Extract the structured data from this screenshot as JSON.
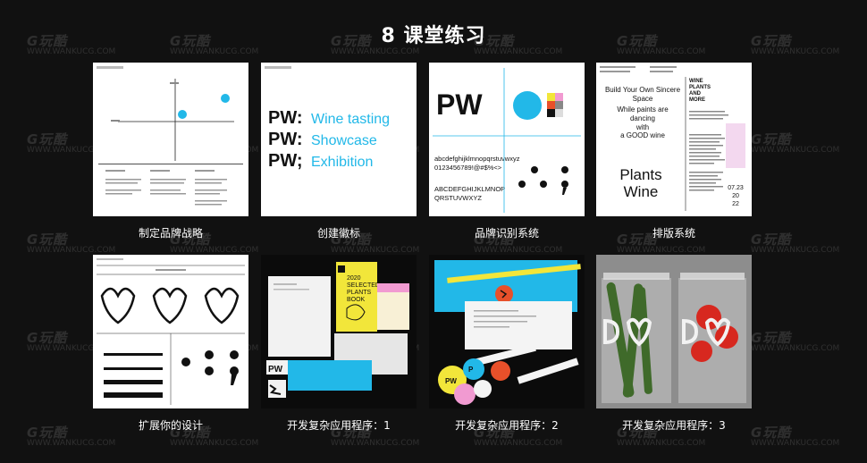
{
  "title": "8 课堂练习",
  "watermark": {
    "brand": "G玩酷",
    "site": "WWW.WANKUCG.COM"
  },
  "cards": [
    {
      "caption": "制定品牌战略"
    },
    {
      "caption": "创建徽标",
      "logo_lines": [
        "Wine tasting",
        "Showcase",
        "Exhibition"
      ]
    },
    {
      "caption": "品牌识别系统",
      "lower": "abcdefghijklmnopqrstuvwxyz",
      "digits": "0123456789!@#$%<>",
      "upper1": "ABCDEFGHIJKLMNOP",
      "upper2": "QRSTUVWXYZ"
    },
    {
      "caption": "排版系统",
      "headline": [
        "Build Your Own Sincere",
        "Space",
        "While paints are",
        "dancing",
        "with",
        "a GOOD wine"
      ],
      "big": [
        "Plants",
        "Wine"
      ],
      "side": [
        "WINE",
        "PLANTS",
        "AND",
        "MORE"
      ],
      "date": [
        "07.23",
        "20",
        "22"
      ]
    },
    {
      "caption": "扩展你的设计"
    },
    {
      "caption": "开发复杂应用程序：1",
      "book": [
        "2020",
        "SELECTED",
        "PLANTS",
        "BOOK"
      ]
    },
    {
      "caption": "开发复杂应用程序：2"
    },
    {
      "caption": "开发复杂应用程序：3"
    }
  ],
  "colors": {
    "accent": "#22b8e8",
    "yellow": "#f2e63a",
    "background": "#111111"
  }
}
